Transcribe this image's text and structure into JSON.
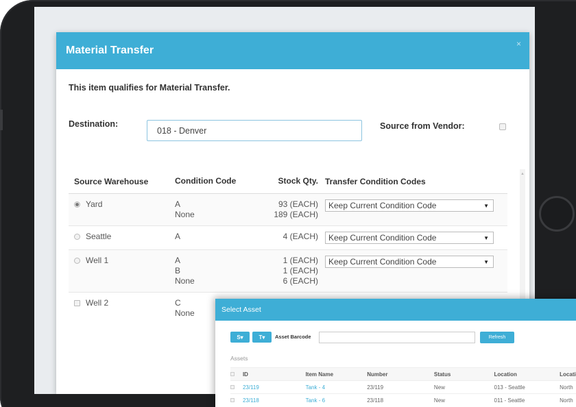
{
  "modal": {
    "title": "Material Transfer",
    "close_glyph": "×",
    "qualify_message": "This item qualifies for Material Transfer.",
    "destination_label": "Destination:",
    "destination_value": "018 - Denver",
    "source_vendor_label": "Source from Vendor:",
    "source_vendor_checked": false
  },
  "transfer_table": {
    "headers": [
      "Source Warehouse",
      "Condition Code",
      "Stock Qty.",
      "Transfer Condition Codes"
    ],
    "rows": [
      {
        "warehouse": "Yard",
        "selector": "radio",
        "selected": true,
        "codes": [
          "A",
          "None"
        ],
        "qty": [
          "93 (EACH)",
          "189 (EACH)"
        ],
        "transfer_code": "Keep Current Condition Code"
      },
      {
        "warehouse": "Seattle",
        "selector": "radio",
        "selected": false,
        "codes": [
          "A"
        ],
        "qty": [
          "4 (EACH)"
        ],
        "transfer_code": "Keep Current Condition Code"
      },
      {
        "warehouse": "Well 1",
        "selector": "radio",
        "selected": false,
        "codes": [
          "A",
          "B",
          "None"
        ],
        "qty": [
          "1 (EACH)",
          "1 (EACH)",
          "6 (EACH)"
        ],
        "transfer_code": "Keep Current Condition Code"
      },
      {
        "warehouse": "Well 2",
        "selector": "checkbox",
        "selected": false,
        "codes": [
          "C",
          "None"
        ],
        "qty": [],
        "transfer_code": ""
      }
    ]
  },
  "select_asset": {
    "title": "Select Asset",
    "tool_buttons": [
      "S▾",
      "T▾"
    ],
    "barcode_label": "Asset Barcode",
    "barcode_value": "",
    "refresh_label": "Refresh",
    "assets_label": "Assets",
    "columns": [
      "ID",
      "Item Name",
      "Number",
      "Status",
      "Location",
      "Locatio"
    ],
    "rows": [
      {
        "id": "23/119",
        "name": "Tank - 4",
        "number": "23/119",
        "status": "New",
        "location": "013 - Seattle",
        "location2": "North"
      },
      {
        "id": "23/118",
        "name": "Tank - 6",
        "number": "23/118",
        "status": "New",
        "location": "011 - Seattle",
        "location2": "North"
      }
    ]
  },
  "colors": {
    "accent": "#3eaed6",
    "device_bezel": "#1e1f21"
  }
}
